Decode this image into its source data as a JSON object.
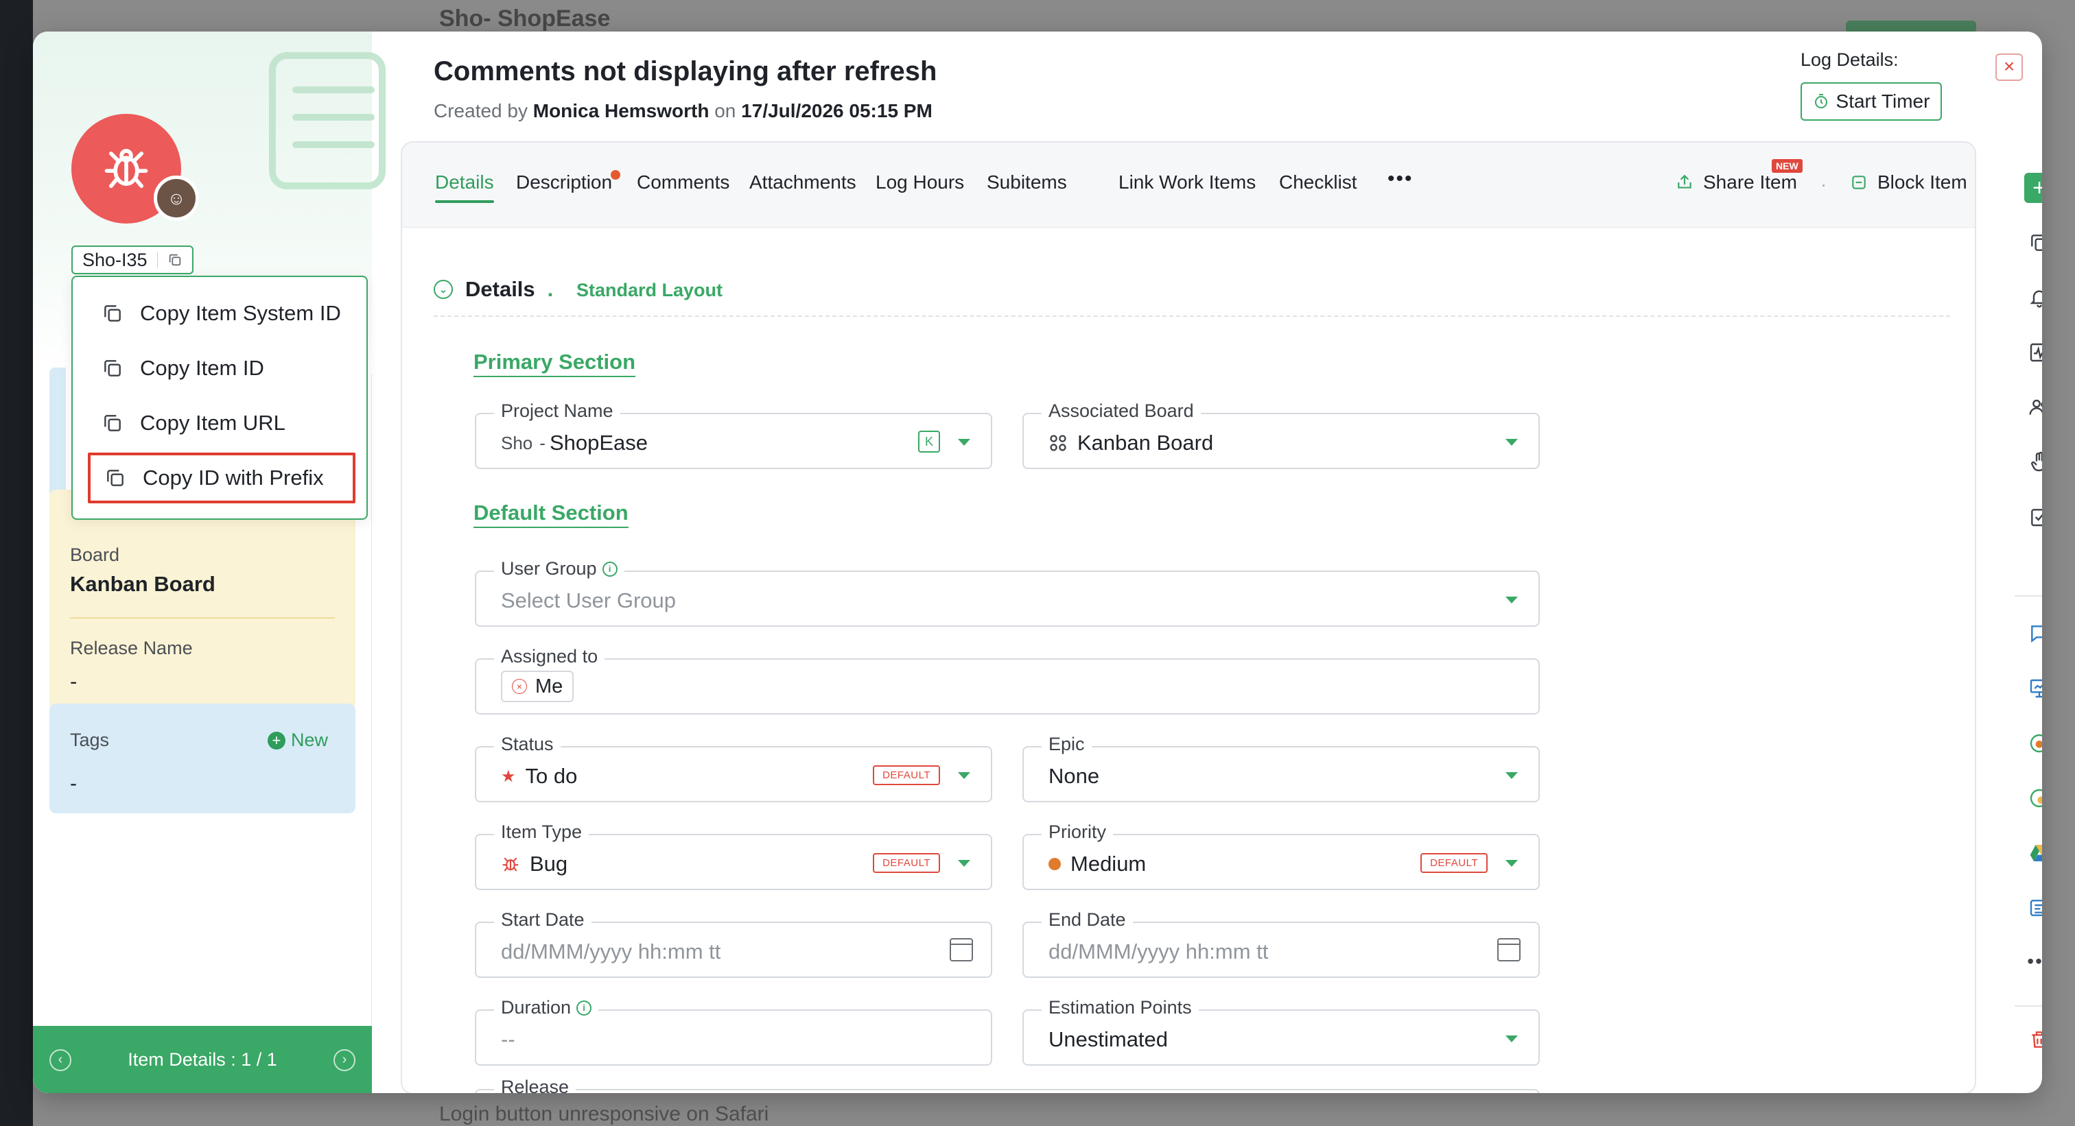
{
  "background": {
    "title": "Sho- ShopEase",
    "bottom_text": "Login button unresponsive on Safari"
  },
  "header": {
    "title": "Comments not displaying after refresh",
    "created_prefix": "Created by",
    "created_by": "Monica Hemsworth",
    "created_on_word": "on",
    "created_on": "17/Jul/2026 05:15 PM",
    "log_label": "Log Details:",
    "start_timer": "Start Timer",
    "close": "×"
  },
  "left": {
    "item_id": "Sho-I35",
    "copy_menu": [
      {
        "label": "Copy Item System ID"
      },
      {
        "label": "Copy Item ID"
      },
      {
        "label": "Copy Item URL"
      },
      {
        "label": "Copy ID with Prefix"
      }
    ],
    "board_label": "Board",
    "board_value": "Kanban Board",
    "release_label": "Release Name",
    "release_value": "-",
    "tags_label": "Tags",
    "tags_value": "-",
    "tags_new": "New",
    "footer": "Item Details : 1 / 1"
  },
  "tabs": [
    {
      "label": "Details",
      "active": true
    },
    {
      "label": "Description"
    },
    {
      "label": "Comments"
    },
    {
      "label": "Attachments"
    },
    {
      "label": "Log Hours"
    },
    {
      "label": "Subitems"
    },
    {
      "label": "Link Work Items"
    },
    {
      "label": "Checklist"
    }
  ],
  "tabs_more": "•••",
  "actions": {
    "share": "Share Item",
    "new_badge": "NEW",
    "dot": ".",
    "block": "Block Item"
  },
  "details": {
    "title": "Details",
    "dot": ".",
    "layout": "Standard Layout",
    "primary_section": "Primary Section",
    "default_section": "Default Section",
    "default_badge": "DEFAULT",
    "fields": {
      "project_name": {
        "label": "Project Name",
        "prefix": "Sho",
        "dash": "-",
        "value": "ShopEase",
        "chip": "K"
      },
      "associated_board": {
        "label": "Associated Board",
        "value": "Kanban Board"
      },
      "user_group": {
        "label": "User Group",
        "placeholder": "Select User Group"
      },
      "assigned_to": {
        "label": "Assigned to",
        "value": "Me"
      },
      "status": {
        "label": "Status",
        "value": "To do"
      },
      "epic": {
        "label": "Epic",
        "value": "None"
      },
      "item_type": {
        "label": "Item Type",
        "value": "Bug"
      },
      "priority": {
        "label": "Priority",
        "value": "Medium"
      },
      "start_date": {
        "label": "Start Date",
        "placeholder": "dd/MMM/yyyy hh:mm tt"
      },
      "end_date": {
        "label": "End Date",
        "placeholder": "dd/MMM/yyyy hh:mm tt"
      },
      "duration": {
        "label": "Duration",
        "value": "--"
      },
      "estimation_points": {
        "label": "Estimation Points",
        "value": "Unestimated"
      },
      "release": {
        "label": "Release"
      }
    }
  },
  "colors": {
    "accent": "#3aa866",
    "danger": "#e0483d",
    "board_card": "#fbf3d5",
    "tags_card": "#d8ebf7",
    "priority_dot": "#e07b2e"
  },
  "toolbar_icons": [
    "add-icon",
    "copy-icon",
    "bell-icon",
    "activity-icon",
    "users-icon",
    "hand-icon",
    "clipboard-check-icon",
    "chat-icon",
    "presentation-icon",
    "integration-icon",
    "integration-alt-icon",
    "drive-icon",
    "form-icon",
    "more-icon",
    "trash-icon"
  ]
}
